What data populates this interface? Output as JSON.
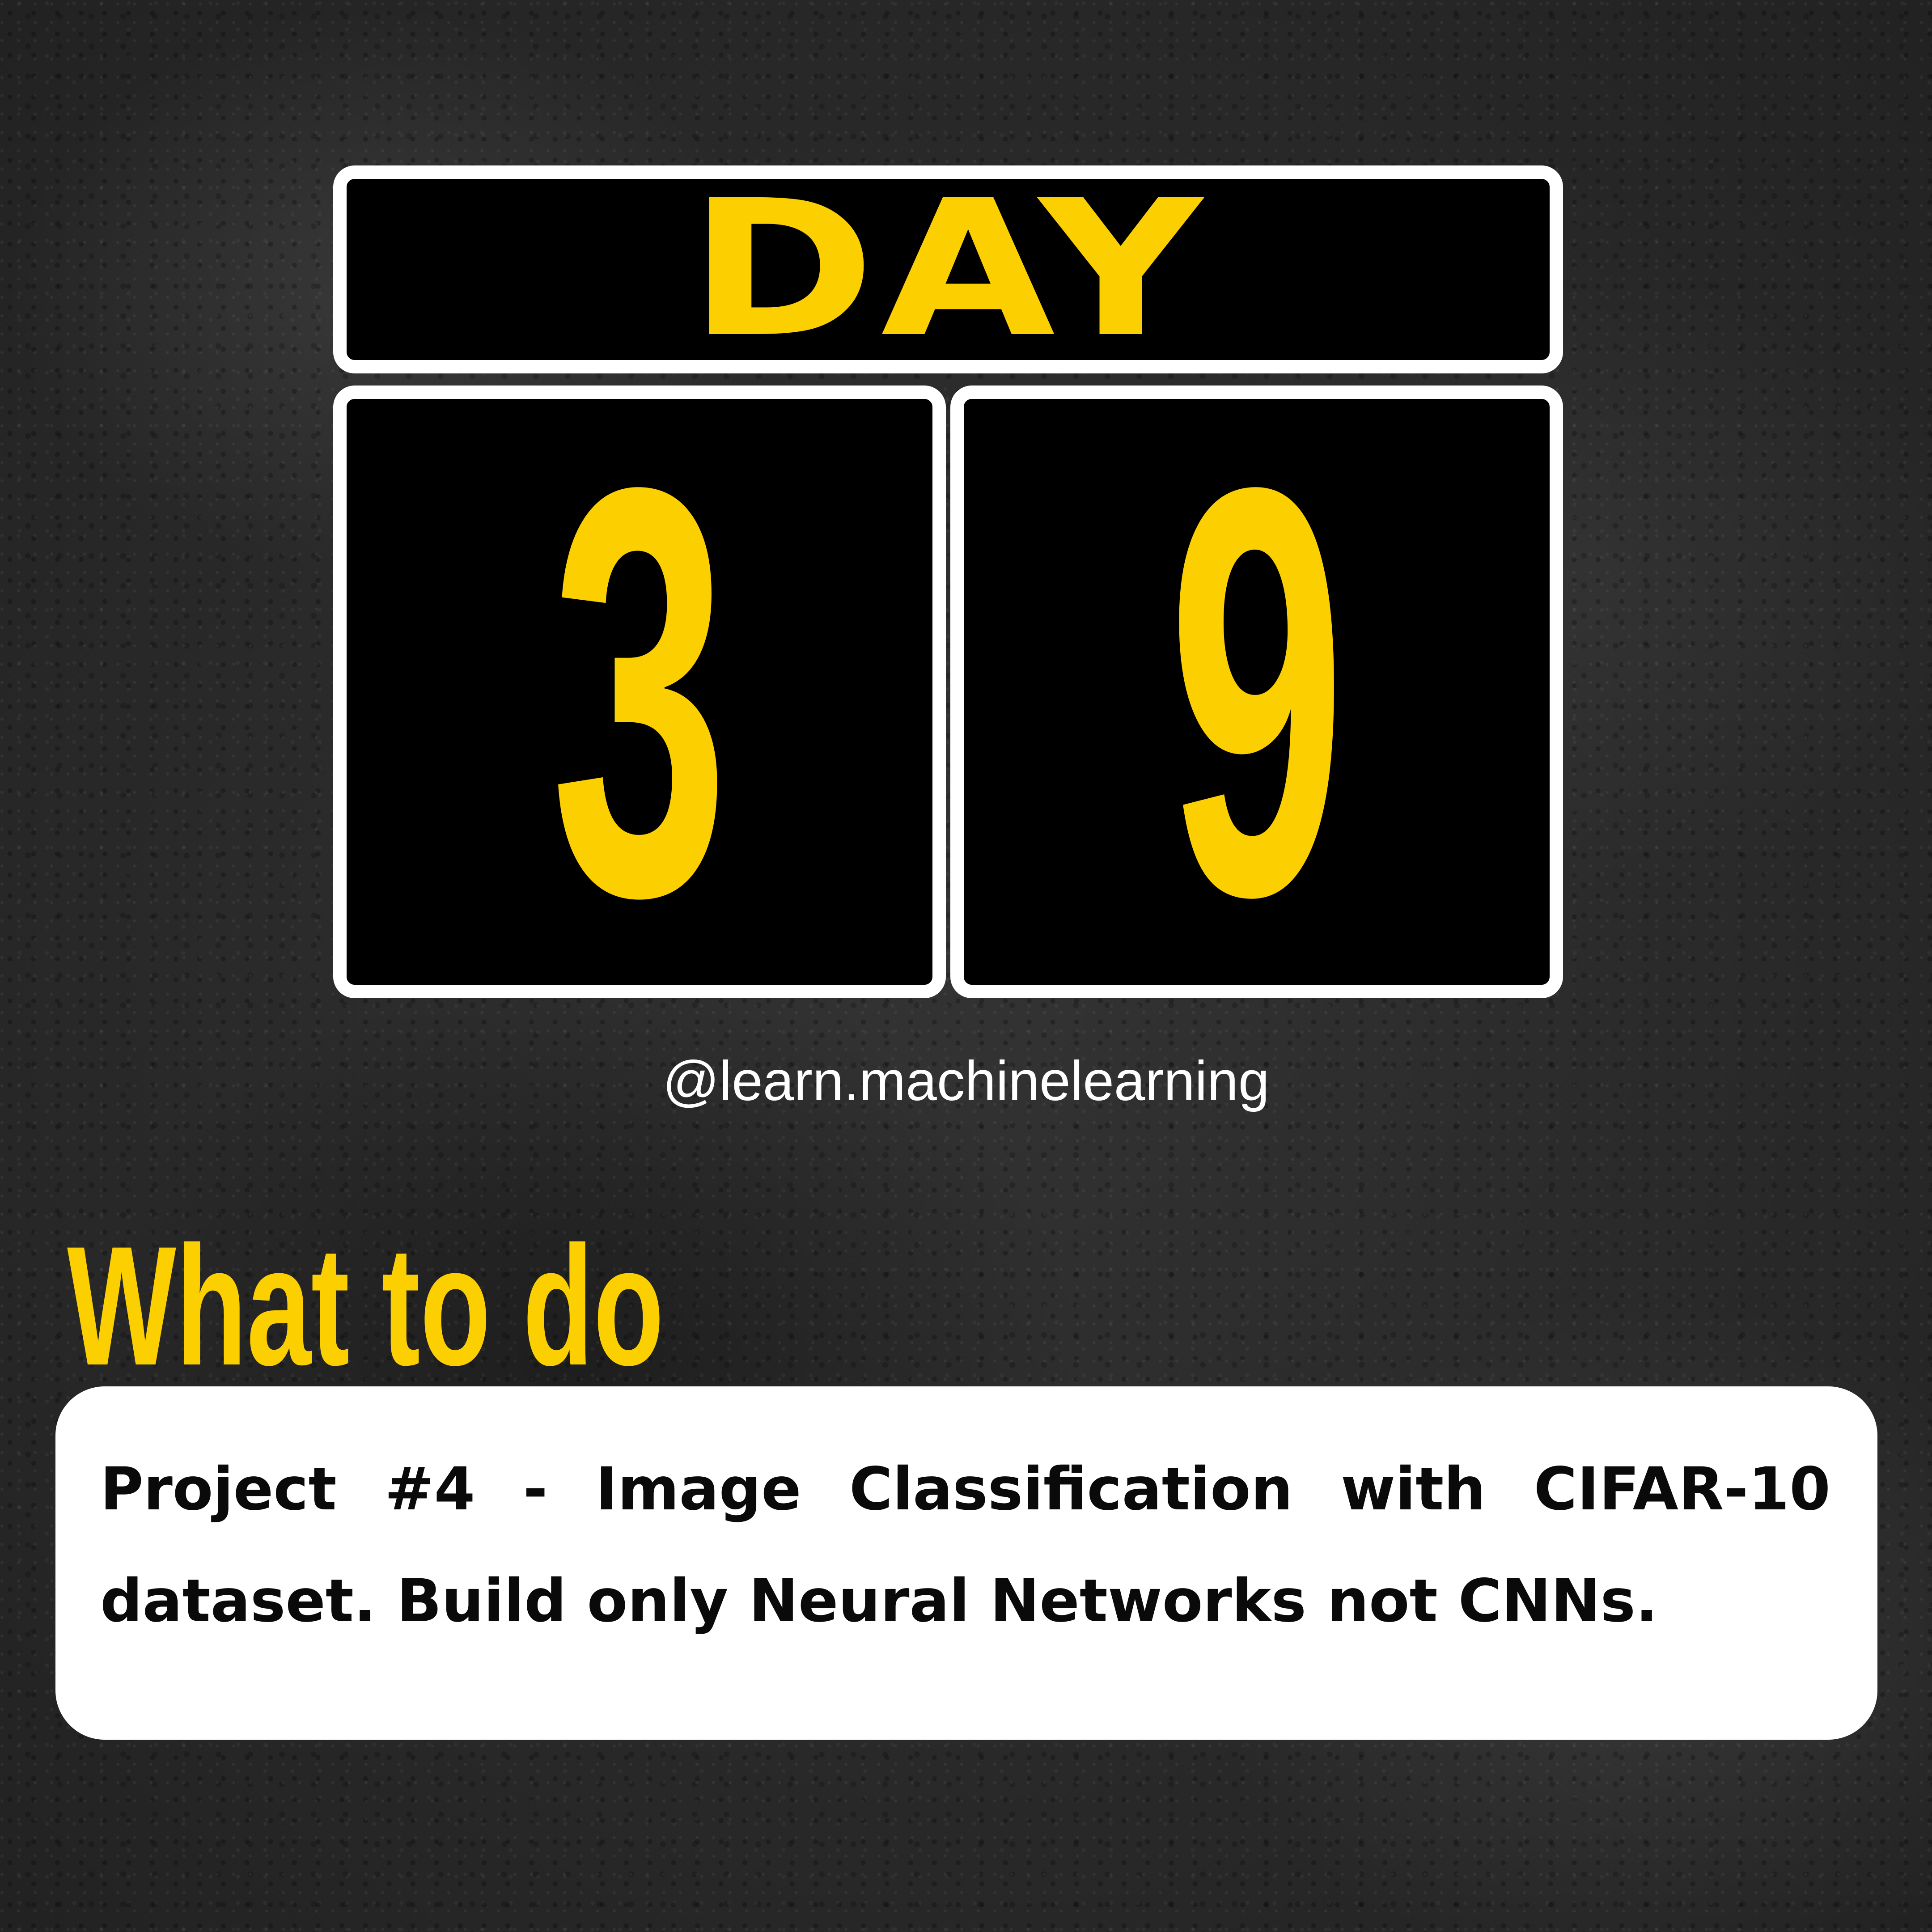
{
  "header": {
    "label": "DAY"
  },
  "counter": {
    "digits": [
      "3",
      "9"
    ]
  },
  "handle": "@learn.machinelearning",
  "section": {
    "title": "What to do"
  },
  "task": {
    "text": "Project #4 - Image Classification with CIFAR-10 dataset. Build only Neural Networks not CNNs."
  },
  "colors": {
    "accent": "#fcd000",
    "panel": "#000000",
    "border": "#ffffff",
    "background": "#2b2b2b",
    "card": "#ffffff"
  }
}
